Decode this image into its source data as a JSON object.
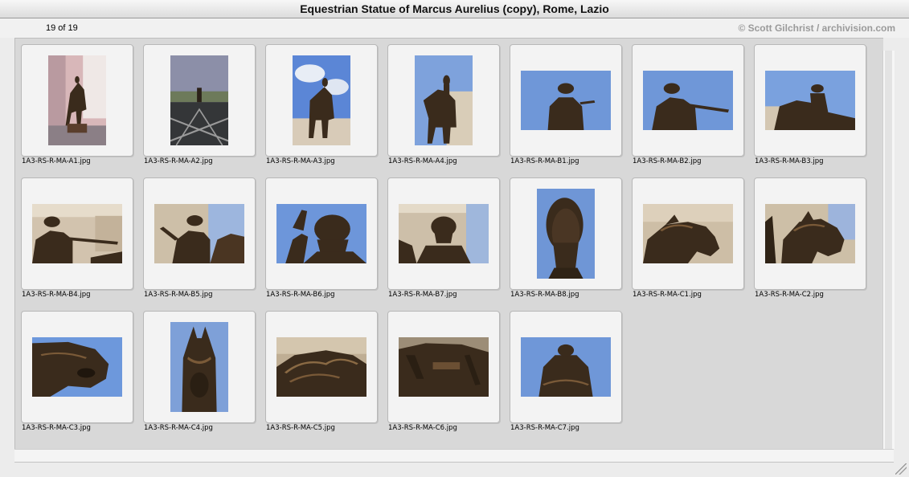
{
  "window": {
    "title": "Equestrian Statue of Marcus Aurelius (copy), Rome, Lazio"
  },
  "header": {
    "count": "19 of 19",
    "credit": "© Scott Gilchrist / archivision.com"
  },
  "thumbnails": [
    {
      "filename": "1A3-RS-R-MA-A1.jpg",
      "orientation": "portrait",
      "scene": "statue-plaza-pink"
    },
    {
      "filename": "1A3-RS-R-MA-A2.jpg",
      "orientation": "portrait",
      "scene": "piazza-distant"
    },
    {
      "filename": "1A3-RS-R-MA-A3.jpg",
      "orientation": "portrait",
      "scene": "statue-sky-clouds"
    },
    {
      "filename": "1A3-RS-R-MA-A4.jpg",
      "orientation": "portrait",
      "scene": "statue-sky-front"
    },
    {
      "filename": "1A3-RS-R-MA-B1.jpg",
      "orientation": "landscape",
      "scene": "rider-back-sky"
    },
    {
      "filename": "1A3-RS-R-MA-B2.jpg",
      "orientation": "landscape",
      "scene": "rider-arm-sky"
    },
    {
      "filename": "1A3-RS-R-MA-B3.jpg",
      "orientation": "landscape",
      "scene": "rider-side-sky"
    },
    {
      "filename": "1A3-RS-R-MA-B4.jpg",
      "orientation": "landscape",
      "scene": "rider-arm-building"
    },
    {
      "filename": "1A3-RS-R-MA-B5.jpg",
      "orientation": "landscape",
      "scene": "rider-front-building"
    },
    {
      "filename": "1A3-RS-R-MA-B6.jpg",
      "orientation": "landscape",
      "scene": "head-hand-sky"
    },
    {
      "filename": "1A3-RS-R-MA-B7.jpg",
      "orientation": "landscape",
      "scene": "head-building"
    },
    {
      "filename": "1A3-RS-R-MA-B8.jpg",
      "orientation": "portrait",
      "scene": "head-closeup-sky"
    },
    {
      "filename": "1A3-RS-R-MA-C1.jpg",
      "orientation": "landscape",
      "scene": "horse-head-building"
    },
    {
      "filename": "1A3-RS-R-MA-C2.jpg",
      "orientation": "landscape",
      "scene": "horse-head-sky"
    },
    {
      "filename": "1A3-RS-R-MA-C3.jpg",
      "orientation": "landscape",
      "scene": "horse-muzzle-sky"
    },
    {
      "filename": "1A3-RS-R-MA-C4.jpg",
      "orientation": "portrait",
      "scene": "horse-front-sky"
    },
    {
      "filename": "1A3-RS-R-MA-C5.jpg",
      "orientation": "landscape",
      "scene": "horse-mane"
    },
    {
      "filename": "1A3-RS-R-MA-C6.jpg",
      "orientation": "landscape",
      "scene": "horse-belly"
    },
    {
      "filename": "1A3-RS-R-MA-C7.jpg",
      "orientation": "landscape",
      "scene": "rider-back-closeup"
    }
  ],
  "colors": {
    "bronze": "#3a2b1c",
    "bronze_light": "#7a5a38",
    "sky": "#6f97d8",
    "stone": "#c9b9a6"
  }
}
